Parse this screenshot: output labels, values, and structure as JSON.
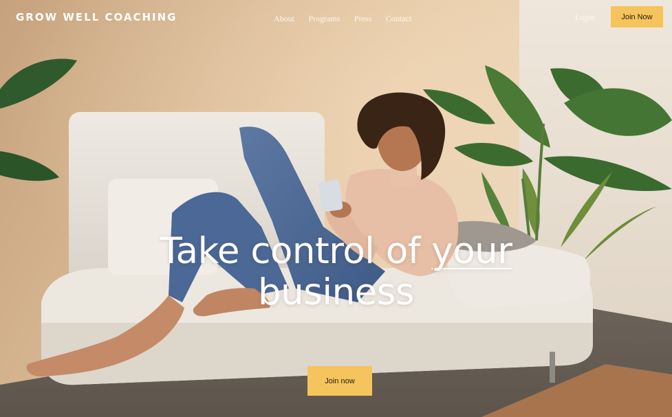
{
  "site": {
    "logo_text": "GROW WELL COACHING"
  },
  "nav": {
    "items": [
      {
        "label": "About"
      },
      {
        "label": "Programs"
      },
      {
        "label": "Press"
      },
      {
        "label": "Contact"
      }
    ],
    "login_label": "Login",
    "join_label": "Join Now"
  },
  "hero": {
    "title_part1": "Take control of ",
    "title_emphasis": "your",
    "title_part2": "business",
    "cta_label": "Join now",
    "image_description_icon": "woman-on-sofa-photo"
  },
  "colors": {
    "accent": "#f6c45d",
    "wall": "#d9b792",
    "floor": "#6e655c",
    "text_on_image": "#ffffff"
  }
}
